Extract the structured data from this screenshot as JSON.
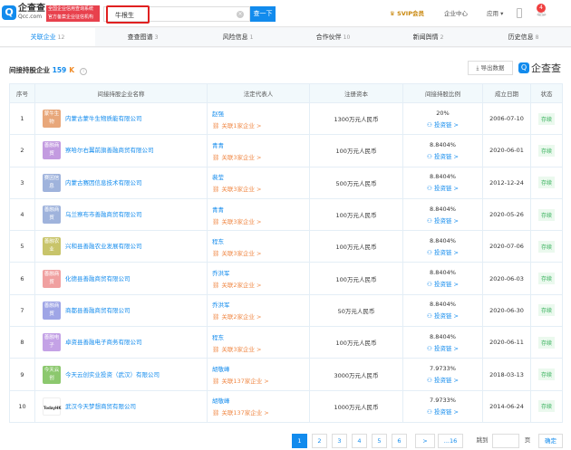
{
  "header": {
    "logo_text": "企查查",
    "logo_sub": "Qcc.com",
    "slogan_lines": [
      "全国企业信用查询系统",
      "官方备案企业征信机构"
    ],
    "search_value": "牛根生",
    "search_button": "查一下",
    "svip": "SVIP会员",
    "enterprise_center": "企业中心",
    "apps": "应用 ▾",
    "notification_count": "4"
  },
  "tabs": [
    {
      "label": "关联企业",
      "count": "12"
    },
    {
      "label": "查查图谱",
      "count": "3"
    },
    {
      "label": "风险信息",
      "count": "1"
    },
    {
      "label": "合作伙伴",
      "count": "10"
    },
    {
      "label": "新闻舆情",
      "count": "2"
    },
    {
      "label": "历史信息",
      "count": "8"
    }
  ],
  "section": {
    "title": "间接持股企业",
    "count": "159",
    "export": "导出数据",
    "watermark": "企查查"
  },
  "columns": [
    "序号",
    "间接持股企业名称",
    "法定代表人",
    "注册资本",
    "间接持股比例",
    "成立日期",
    "状态"
  ],
  "chain_label": "投资链 >",
  "rows": [
    {
      "no": "1",
      "logo": "蒙牛生物",
      "color": "#e8a77a",
      "name": "内蒙古蒙牛生物质能有限公司",
      "rep": "赵强",
      "rel": "关联1家企业 >",
      "capital": "1300万元人民币",
      "ratio": "20%",
      "date": "2006-07-10",
      "status": "存续"
    },
    {
      "no": "2",
      "logo": "善融商贸",
      "color": "#c39be0",
      "name": "察哈尔右翼前旗善融商贸有限公司",
      "rep": "青青",
      "rel": "关联3家企业 >",
      "capital": "100万元人民币",
      "ratio": "8.8404%",
      "date": "2020-06-01",
      "status": "存续"
    },
    {
      "no": "3",
      "logo": "赛因信息",
      "color": "#9fb3dc",
      "name": "内蒙古赛因信息技术有限公司",
      "rep": "裴莹",
      "rel": "关联3家企业 >",
      "capital": "500万元人民币",
      "ratio": "8.8404%",
      "date": "2012-12-24",
      "status": "存续"
    },
    {
      "no": "4",
      "logo": "善融商贸",
      "color": "#9fb3dc",
      "name": "乌兰察布市善融商贸有限公司",
      "rep": "青青",
      "rel": "关联3家企业 >",
      "capital": "100万元人民币",
      "ratio": "8.8404%",
      "date": "2020-05-26",
      "status": "存续"
    },
    {
      "no": "5",
      "logo": "善融农业",
      "color": "#c8c46a",
      "name": "兴和县善融农业发展有限公司",
      "rep": "程东",
      "rel": "关联3家企业 >",
      "capital": "100万元人民币",
      "ratio": "8.8404%",
      "date": "2020-07-06",
      "status": "存续"
    },
    {
      "no": "6",
      "logo": "善融商贸",
      "color": "#f0a0a0",
      "name": "化德县善融商贸有限公司",
      "rep": "乔洪军",
      "rel": "关联2家企业 >",
      "capital": "100万元人民币",
      "ratio": "8.8404%",
      "date": "2020-06-03",
      "status": "存续"
    },
    {
      "no": "7",
      "logo": "善融商贸",
      "color": "#9fa5e6",
      "name": "商都县善融商贸有限公司",
      "rep": "乔洪军",
      "rel": "关联2家企业 >",
      "capital": "50万元人民币",
      "ratio": "8.8404%",
      "date": "2020-06-30",
      "status": "存续"
    },
    {
      "no": "8",
      "logo": "善融电子",
      "color": "#c4a2e6",
      "name": "卓资县善融电子商务有限公司",
      "rep": "程东",
      "rel": "关联3家企业 >",
      "capital": "100万元人民币",
      "ratio": "8.8404%",
      "date": "2020-06-11",
      "status": "存续"
    },
    {
      "no": "9",
      "logo": "今天云创",
      "color": "#8cc86e",
      "name": "今天云创实业投资（武汉）有限公司",
      "rep": "胡敬峰",
      "rel": "关联137家企业 >",
      "capital": "3000万元人民币",
      "ratio": "7.9733%",
      "date": "2018-03-13",
      "status": "存续"
    },
    {
      "no": "10",
      "logo": "TodayHK",
      "color": "#ffffff",
      "name": "武汉今天梦想商贸有限公司",
      "rep": "胡敬峰",
      "rel": "关联137家企业 >",
      "capital": "1000万元人民币",
      "ratio": "7.9733%",
      "date": "2014-06-24",
      "status": "存续"
    }
  ],
  "pagination": {
    "pages": [
      "1",
      "2",
      "3",
      "4",
      "5",
      "6"
    ],
    "next": ">",
    "last": "...16",
    "goto": "跳到",
    "page_unit": "页",
    "confirm": "确定"
  }
}
